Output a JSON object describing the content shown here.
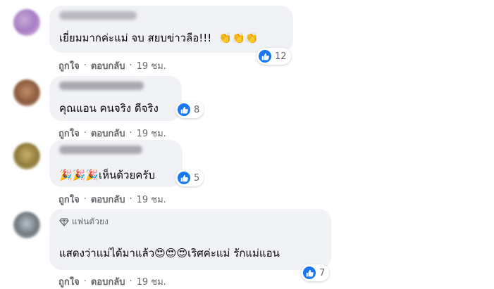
{
  "actions": {
    "like": "ถูกใจ",
    "reply": "ตอบกลับ",
    "time": "19 ชม.",
    "separator": "·"
  },
  "comments": [
    {
      "text": "เยี่ยมมากค่ะแม่ จบ สยบข่าวลือ!!!",
      "emojis": "👏👏👏",
      "reaction_count": "12"
    },
    {
      "text": "คุณแอน คนจริง ดีจริง",
      "emojis": "",
      "reaction_count": "8"
    },
    {
      "text": "เห็นด้วยครับ",
      "emojis": "🎉🎉🎉",
      "reaction_count": "5"
    },
    {
      "badge": "แฟนตัวยง",
      "text_before": "แสดงว่าแม่ได้มาแล้ว",
      "emojis": "😍😍😍",
      "text_after": "เริศค่ะแม่ รักแม่แอน",
      "reaction_count": "7"
    }
  ],
  "colors": {
    "bubble": "#f0f2f5",
    "meta_text": "#65676b",
    "like_blue": "#1877f2"
  }
}
